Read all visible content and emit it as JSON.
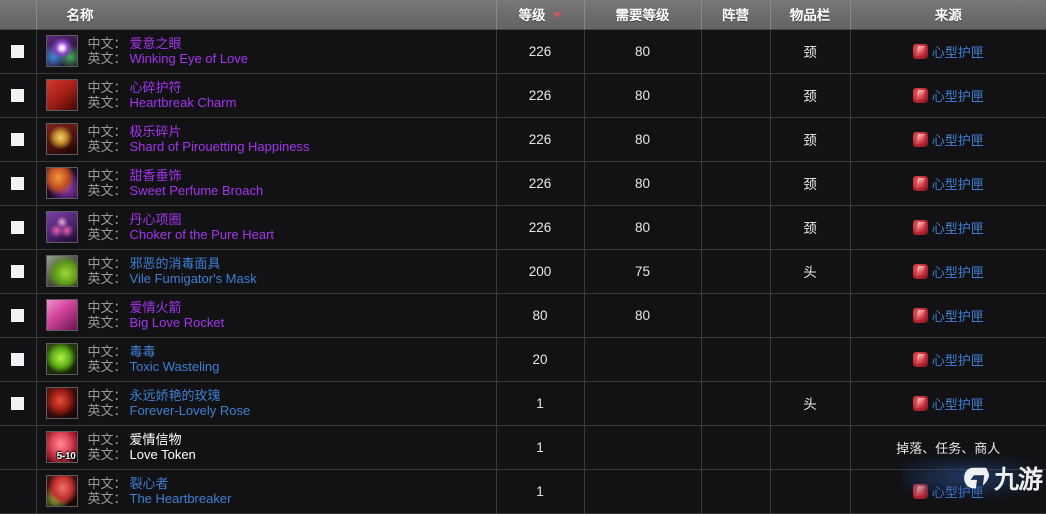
{
  "table": {
    "columns": [
      {
        "key": "check",
        "label": ""
      },
      {
        "key": "name",
        "label": "名称"
      },
      {
        "key": "level",
        "label": "等级",
        "sorted": true,
        "sort_direction": "desc"
      },
      {
        "key": "req",
        "label": "需要等级"
      },
      {
        "key": "faction",
        "label": "阵营"
      },
      {
        "key": "slot",
        "label": "物品栏"
      },
      {
        "key": "source",
        "label": "来源"
      }
    ],
    "labels": {
      "chinese": "中文：",
      "english": "英文："
    },
    "rows": [
      {
        "checkbox": true,
        "icon": "winking-eye-of-love-icon",
        "stack": "",
        "name_cn": "爱意之眼",
        "name_en": "Winking Eye of Love",
        "quality": "epic",
        "level": "226",
        "req": "80",
        "faction": "",
        "slot": "颈",
        "source": "心型护匣",
        "source_is_link": true
      },
      {
        "checkbox": true,
        "icon": "heartbreak-charm-icon",
        "stack": "",
        "name_cn": "心碎护符",
        "name_en": "Heartbreak Charm",
        "quality": "epic",
        "level": "226",
        "req": "80",
        "faction": "",
        "slot": "颈",
        "source": "心型护匣",
        "source_is_link": true
      },
      {
        "checkbox": true,
        "icon": "shard-of-pirouetting-happiness-icon",
        "stack": "",
        "name_cn": "极乐碎片",
        "name_en": "Shard of Pirouetting Happiness",
        "quality": "epic",
        "level": "226",
        "req": "80",
        "faction": "",
        "slot": "颈",
        "source": "心型护匣",
        "source_is_link": true
      },
      {
        "checkbox": true,
        "icon": "sweet-perfume-broach-icon",
        "stack": "",
        "name_cn": "甜香垂饰",
        "name_en": "Sweet Perfume Broach",
        "quality": "epic",
        "level": "226",
        "req": "80",
        "faction": "",
        "slot": "颈",
        "source": "心型护匣",
        "source_is_link": true
      },
      {
        "checkbox": true,
        "icon": "choker-of-the-pure-heart-icon",
        "stack": "",
        "name_cn": "丹心项圈",
        "name_en": "Choker of the Pure Heart",
        "quality": "epic",
        "level": "226",
        "req": "80",
        "faction": "",
        "slot": "颈",
        "source": "心型护匣",
        "source_is_link": true
      },
      {
        "checkbox": true,
        "icon": "vile-fumigators-mask-icon",
        "stack": "",
        "name_cn": "邪恶的消毒面具",
        "name_en": "Vile Fumigator's Mask",
        "quality": "rare",
        "level": "200",
        "req": "75",
        "faction": "",
        "slot": "头",
        "source": "心型护匣",
        "source_is_link": true
      },
      {
        "checkbox": true,
        "icon": "big-love-rocket-icon",
        "stack": "",
        "name_cn": "爱情火箭",
        "name_en": "Big Love Rocket",
        "quality": "epic",
        "level": "80",
        "req": "80",
        "faction": "",
        "slot": "",
        "source": "心型护匣",
        "source_is_link": true
      },
      {
        "checkbox": true,
        "icon": "toxic-wasteling-icon",
        "stack": "",
        "name_cn": "毒毒",
        "name_en": "Toxic Wasteling",
        "quality": "rare",
        "level": "20",
        "req": "",
        "faction": "",
        "slot": "",
        "source": "心型护匣",
        "source_is_link": true
      },
      {
        "checkbox": true,
        "icon": "forever-lovely-rose-icon",
        "stack": "",
        "name_cn": "永远娇艳的玫瑰",
        "name_en": "Forever-Lovely Rose",
        "quality": "rare",
        "level": "1",
        "req": "",
        "faction": "",
        "slot": "头",
        "source": "心型护匣",
        "source_is_link": true
      },
      {
        "checkbox": false,
        "icon": "love-token-icon",
        "stack": "5-10",
        "name_cn": "爱情信物",
        "name_en": "Love Token",
        "quality": "common",
        "level": "1",
        "req": "",
        "faction": "",
        "slot": "",
        "source": "掉落、任务、商人",
        "source_is_link": false
      },
      {
        "checkbox": false,
        "icon": "the-heartbreaker-icon",
        "stack": "",
        "name_cn": "裂心者",
        "name_en": "The Heartbreaker",
        "quality": "rare",
        "level": "1",
        "req": "",
        "faction": "",
        "slot": "",
        "source": "心型护匣",
        "source_is_link": true
      }
    ]
  },
  "watermark": {
    "mark": "५",
    "text": "九游"
  },
  "colors": {
    "epic": "#a335ee",
    "rare": "#3f7fd4",
    "common": "#ffffff",
    "link": "#3f7fd4",
    "sort_caret": "#c45a63",
    "header_bg": "#6e6e6e",
    "row_bg": "#121214",
    "grid": "#3a3a3c"
  }
}
